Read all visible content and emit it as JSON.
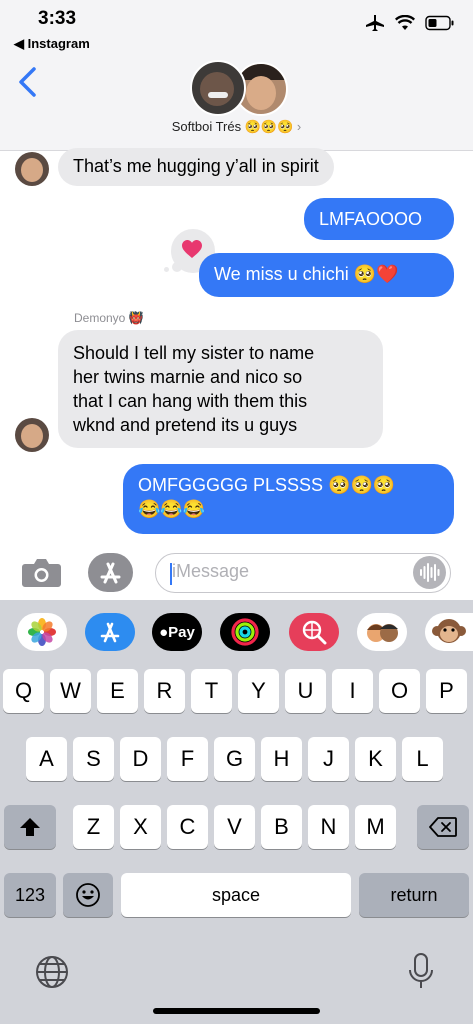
{
  "status": {
    "time": "3:33",
    "back_app": "Instagram"
  },
  "conversation": {
    "name": "Softboi Trés 🥺🥺🥺",
    "chevron": "›"
  },
  "messages": {
    "m1": "That’s me hugging y’all in spirit",
    "m2": "LMFAOOOO",
    "m3": "We miss u chichi 🥺❤️",
    "sender4": "Demonyo 👹",
    "m4_line1": "Should I tell my sister to name",
    "m4_line2": "her twins marnie and nico  so",
    "m4_line3": "that I can hang with them this",
    "m4_line4": "wknd and pretend its u guys",
    "m5_line1": "OMFGGGGG PLSSSS 🥺🥺🥺",
    "m5_line2": "😂😂😂"
  },
  "input": {
    "placeholder": "iMessage"
  },
  "apps": {
    "applepay_label": "Pay"
  },
  "keyboard": {
    "row1": [
      "Q",
      "W",
      "E",
      "R",
      "T",
      "Y",
      "U",
      "I",
      "O",
      "P"
    ],
    "row2": [
      "A",
      "S",
      "D",
      "F",
      "G",
      "H",
      "J",
      "K",
      "L"
    ],
    "row3": [
      "Z",
      "X",
      "C",
      "V",
      "B",
      "N",
      "M"
    ],
    "numbers": "123",
    "space": "space",
    "return": "return"
  },
  "colors": {
    "accent": "#3478f6",
    "incoming": "#e9e9eb",
    "tapback": "#e8386f"
  }
}
